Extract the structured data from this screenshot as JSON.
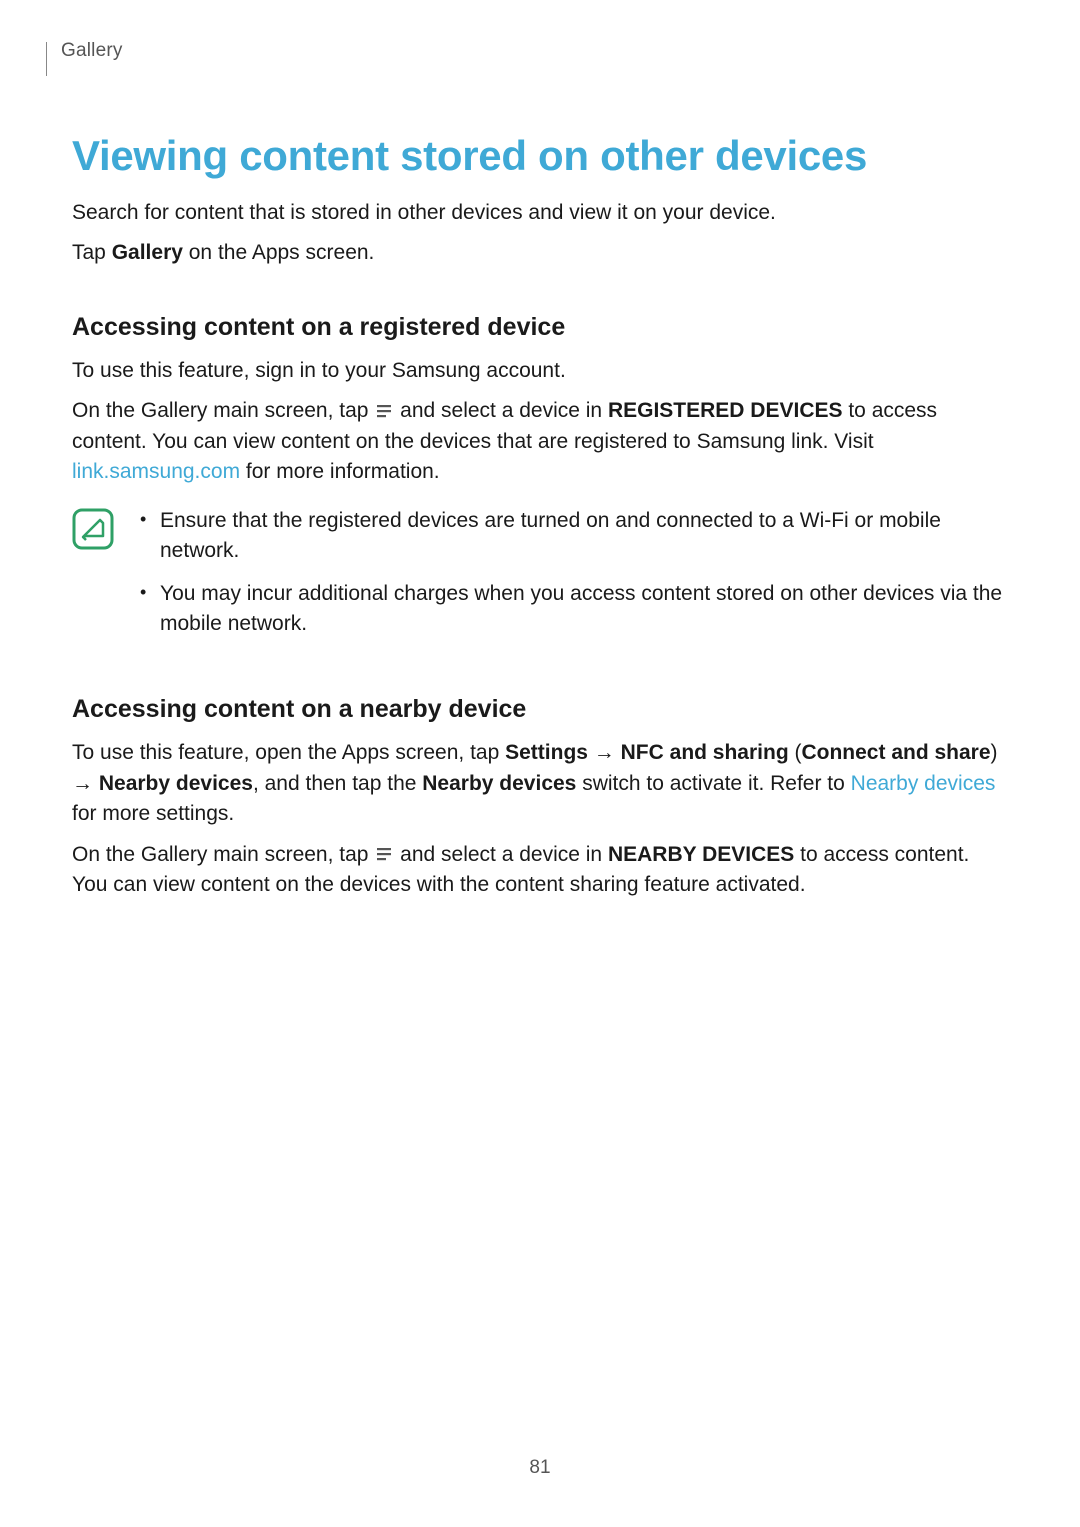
{
  "breadcrumb": "Gallery",
  "heading": "Viewing content stored on other devices",
  "intro1": "Search for content that is stored in other devices and view it on your device.",
  "intro2_pre": "Tap ",
  "intro2_bold": "Gallery",
  "intro2_post": " on the Apps screen.",
  "section1": {
    "heading": "Accessing content on a registered device",
    "p1": "To use this feature, sign in to your Samsung account.",
    "p2_pre": "On the Gallery main screen, tap ",
    "p2_mid": " and select a device in ",
    "p2_bold": "REGISTERED DEVICES",
    "p2_post": " to access content. You can view content on the devices that are registered to Samsung link. Visit ",
    "p2_link": "link.samsung.com",
    "p2_tail": " for more information.",
    "note1": "Ensure that the registered devices are turned on and connected to a Wi-Fi or mobile network.",
    "note2": "You may incur additional charges when you access content stored on other devices via the mobile network."
  },
  "section2": {
    "heading": "Accessing content on a nearby device",
    "p1_pre": "To use this feature, open the Apps screen, tap ",
    "p1_b1": "Settings",
    "p1_arrow": " → ",
    "p1_b2": "NFC and sharing",
    "p1_paren_open": " (",
    "p1_b3": "Connect and share",
    "p1_paren_close": ") ",
    "p1_arrow2": "→ ",
    "p1_b4": "Nearby devices",
    "p1_mid": ", and then tap the ",
    "p1_b5": "Nearby devices",
    "p1_post": " switch to activate it. Refer to ",
    "p1_link": "Nearby devices",
    "p1_tail": " for more settings.",
    "p2_pre": "On the Gallery main screen, tap ",
    "p2_mid": " and select a device in ",
    "p2_bold": "NEARBY DEVICES",
    "p2_post": " to access content. You can view content on the devices with the content sharing feature activated."
  },
  "page_number": "81"
}
